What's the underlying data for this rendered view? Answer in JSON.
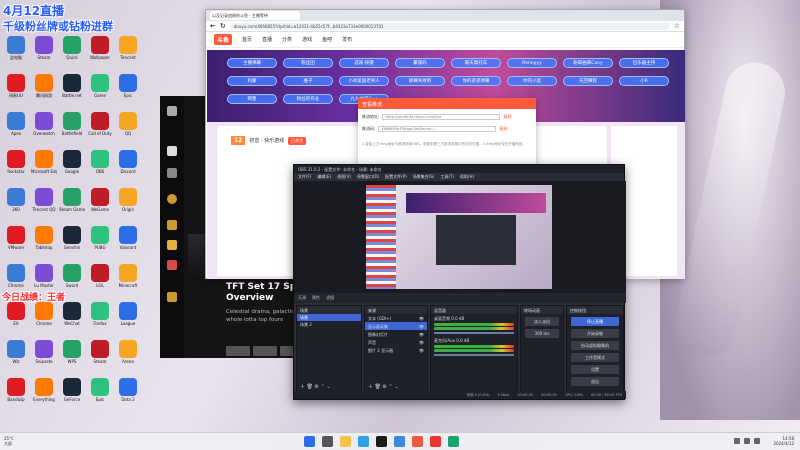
{
  "overlay": {
    "line1": "4月12直播",
    "line2": "千级粉丝牌或钻粉进群",
    "line3": "今日战绩：王者"
  },
  "desktop_icons": [
    "此电脑",
    "Steam",
    "Quick",
    "Wallpaper",
    "Tencent",
    "网易UU",
    "腾讯网游",
    "Battle.net",
    "Game",
    "Epic",
    "Apex",
    "Overwatch",
    "Battlefield",
    "Call of Duty",
    "QQ",
    "Rockstar",
    "Microsoft Edge",
    "Google",
    "OBS",
    "Discord",
    "360",
    "Tencent QQ",
    "Steam Game",
    "WeGame",
    "Origin",
    "VMware",
    "Tabletop",
    "Genshin",
    "PUBG",
    "Valorant",
    "Chrome",
    "Lu Master",
    "Sword",
    "LOL",
    "Minecraft",
    "EA",
    "Chrome",
    "WeChat",
    "Firefox",
    "League",
    "Wiz",
    "Snipaste",
    "WPS",
    "Steam",
    "Arena",
    "Bandizip",
    "Everything",
    "GeForce",
    "Epic",
    "Dota 2"
  ],
  "launcher": {
    "title": "TFT Set 17 Space Overview",
    "desc": "Celestial drama, galactic chaos, and a whole lotta top fours"
  },
  "browser": {
    "tab": "以及记录战绩的斗鱼 · 主播等待",
    "url": "douyu.com/4666855?dyshid=a12431-4b55c57f...b4323a733e0000013701",
    "logo": "斗鱼",
    "nav": [
      "首页",
      "直播",
      "分类",
      "游戏",
      "鱼吧",
      "发布"
    ],
    "banner_buttons": [
      "主播弹幕",
      "粉丝团",
      "选观·按键",
      "聚观码",
      "聊天摩托车",
      "Rennyyy",
      "粉碎曲库Cany",
      "出乐器主持",
      "利蒙",
      "维子",
      "小冰美国老男人",
      "联赛失败吧",
      "你的弟弟弹幕",
      "你的小蛋",
      "先回赛程",
      "小R",
      "网鲁",
      "粉丝的作业",
      "九九曲目Quo"
    ],
    "streamer_level": "12",
    "streamer_name": "初音 · 快乐游戏",
    "follow_label": "已关注"
  },
  "modal": {
    "title": "查看推流",
    "row1_label": "推流地址:",
    "row1_value": "rtmp://sendtc3a.douyu.com/live",
    "row1_copy": "复制",
    "row2_label": "推流码:",
    "row2_value": "4666855rrFSttqpx?wsSecret=...",
    "row2_copy": "复制",
    "note": "1.复制上方rtmp地址与推流码到OBS，粘贴到第三方推流设置中的对应位置。2.rtmp地址仅在开播有效。"
  },
  "obs": {
    "title": "OBS 31.0.2 - 配置文件: 未命名 - 场景: 未命名",
    "menu": [
      "文件(F)",
      "编辑(E)",
      "视图(V)",
      "停靠窗口(D)",
      "配置文件(P)",
      "场景集合(S)",
      "工具(T)",
      "帮助(H)"
    ],
    "bar": [
      "无源",
      "属性",
      "滤镜"
    ],
    "scenes_header": "场景",
    "scenes": [
      "场景",
      "场景 2"
    ],
    "sources_header": "来源",
    "sources": [
      "文本 (GDI+)",
      "显示器采集",
      "图像幻灯片",
      "声音",
      "图片 2 显示器"
    ],
    "mixer_header": "混音器",
    "mixer": [
      {
        "name": "桌面音频",
        "db": "0.0 dB"
      },
      {
        "name": "麦克风/Aux",
        "db": "0.0 dB"
      }
    ],
    "transitions_header": "转场动画",
    "transition": "淡入淡出",
    "duration": "300 ms",
    "controls_header": "控制按钮",
    "controls": [
      "停止直播",
      "开始录制",
      "启动虚拟摄像机",
      "工作室模式",
      "设置",
      "退出"
    ],
    "status": [
      "丢帧 0 (0.0%)",
      "0 kbps",
      "00:00:00",
      "00:00:00",
      "CPU: 0.8%",
      "60.00 / 60.00 FPS"
    ]
  },
  "taskbar": {
    "weather_temp": "25°C",
    "weather_desc": "大部",
    "time": "14:58",
    "date": "2024/4/12"
  }
}
